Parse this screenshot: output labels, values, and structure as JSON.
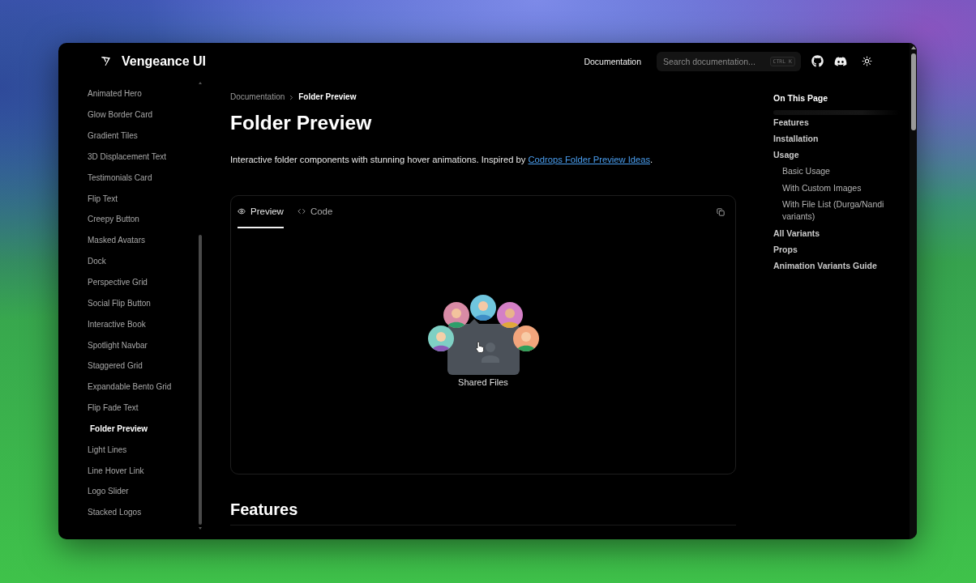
{
  "header": {
    "logo": "Vengeance UI",
    "nav_link": "Documentation",
    "search": {
      "placeholder": "Search documentation...",
      "shortcut": "CTRL K"
    }
  },
  "sidebar": {
    "items": [
      {
        "label": "Animated Hero",
        "selected": false
      },
      {
        "label": "Glow Border Card",
        "selected": false
      },
      {
        "label": "Gradient Tiles",
        "selected": false
      },
      {
        "label": "3D Displacement Text",
        "selected": false
      },
      {
        "label": "Testimonials Card",
        "selected": false
      },
      {
        "label": "Flip Text",
        "selected": false
      },
      {
        "label": "Creepy Button",
        "selected": false
      },
      {
        "label": "Masked Avatars",
        "selected": false
      },
      {
        "label": "Dock",
        "selected": false
      },
      {
        "label": "Perspective Grid",
        "selected": false
      },
      {
        "label": "Social Flip Button",
        "selected": false
      },
      {
        "label": "Interactive Book",
        "selected": false
      },
      {
        "label": "Spotlight Navbar",
        "selected": false
      },
      {
        "label": "Staggered Grid",
        "selected": false
      },
      {
        "label": "Expandable Bento Grid",
        "selected": false
      },
      {
        "label": "Flip Fade Text",
        "selected": false
      },
      {
        "label": "Folder Preview",
        "selected": true
      },
      {
        "label": "Light Lines",
        "selected": false
      },
      {
        "label": "Line Hover Link",
        "selected": false
      },
      {
        "label": "Logo Slider",
        "selected": false
      },
      {
        "label": "Stacked Logos",
        "selected": false
      }
    ]
  },
  "breadcrumb": [
    "Documentation",
    "Folder Preview"
  ],
  "title": "Folder Preview",
  "description": {
    "text": "Interactive folder components with stunning hover animations. Inspired by",
    "link": "Codrops Folder Preview Ideas",
    "end": "."
  },
  "preview_card": {
    "tabs": [
      {
        "label": "Preview",
        "kind": "preview",
        "selected": true
      },
      {
        "label": "Code",
        "kind": "code",
        "selected": false
      }
    ],
    "folder_label": "Shared Files"
  },
  "section_heading": "Features",
  "toc": {
    "title": "On This Page",
    "items": [
      {
        "label": "Features"
      },
      {
        "label": "Installation"
      },
      {
        "label": "Usage",
        "children": [
          {
            "label": "Basic Usage"
          },
          {
            "label": "With Custom Images"
          },
          {
            "label": "With File List (Durga/Nandi variants)"
          }
        ]
      },
      {
        "label": "All Variants"
      },
      {
        "label": "Props"
      },
      {
        "label": "Animation Variants Guide"
      }
    ]
  }
}
